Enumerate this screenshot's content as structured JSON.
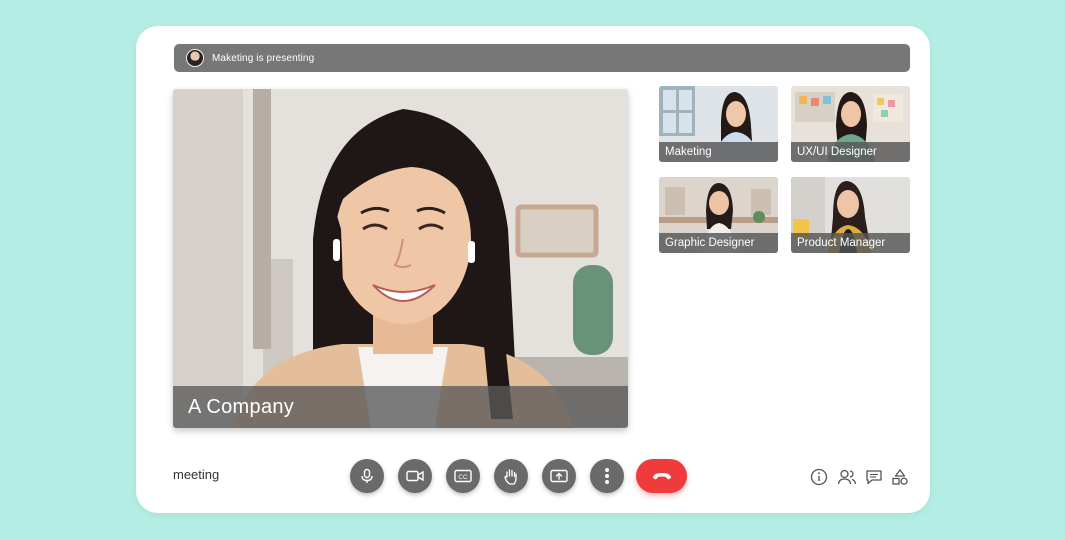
{
  "presenting_bar": {
    "text": "Maketing is presenting",
    "avatar_icon": "presenter-avatar"
  },
  "main_video": {
    "name": "A Company"
  },
  "participants": [
    {
      "name": "Maketing"
    },
    {
      "name": "UX/UI Designer"
    },
    {
      "name": "Graphic Designer"
    },
    {
      "name": "Product Manager"
    }
  ],
  "footer": {
    "meeting_label": "meeting"
  },
  "controls": [
    {
      "icon": "microphone-icon"
    },
    {
      "icon": "camera-icon"
    },
    {
      "icon": "captions-icon"
    },
    {
      "icon": "raise-hand-icon"
    },
    {
      "icon": "present-screen-icon"
    },
    {
      "icon": "more-options-icon"
    },
    {
      "icon": "end-call-icon"
    }
  ],
  "side_icons": [
    {
      "icon": "info-icon"
    },
    {
      "icon": "people-icon"
    },
    {
      "icon": "chat-icon"
    },
    {
      "icon": "activities-icon"
    }
  ],
  "colors": {
    "background": "#b3ede3",
    "card": "#ffffff",
    "control": "#6a6a6a",
    "end_call": "#ef3b3b",
    "bar": "#777777"
  }
}
